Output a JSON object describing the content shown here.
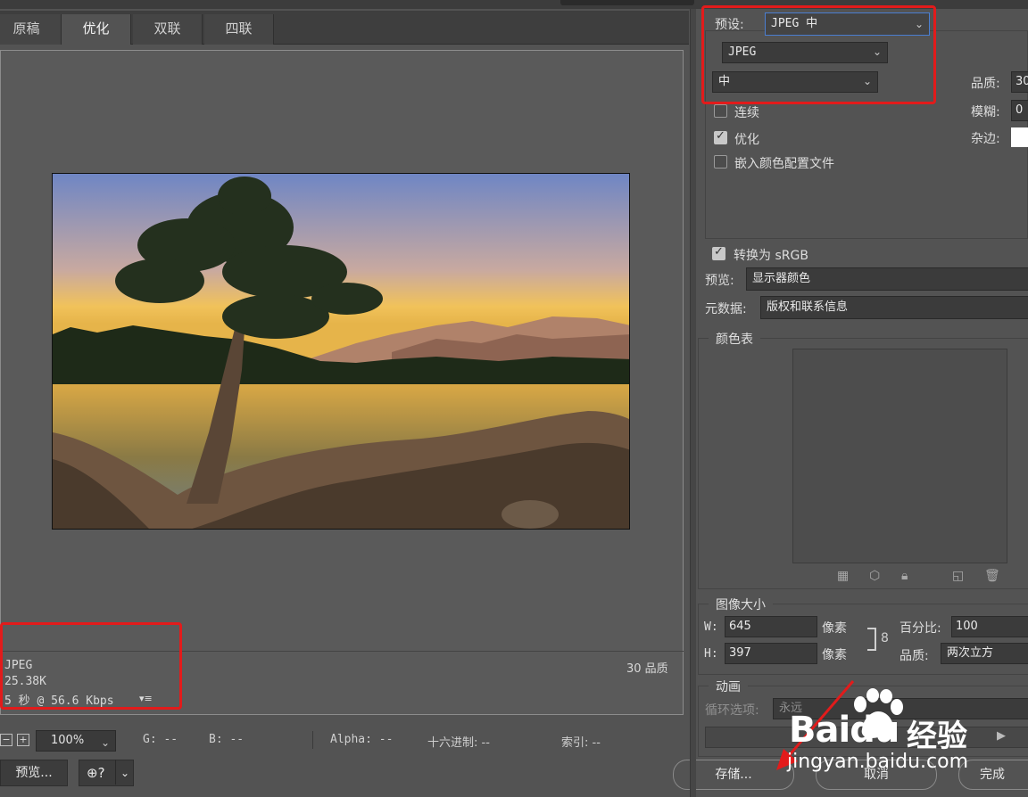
{
  "tabs": [
    {
      "label": "原稿",
      "active": false
    },
    {
      "label": "优化",
      "active": true
    },
    {
      "label": "双联",
      "active": false
    },
    {
      "label": "四联",
      "active": false
    }
  ],
  "image_info": {
    "format": "JPEG",
    "size": "25.38K",
    "time": "5 秒 @ 56.6 Kbps",
    "quality": "30 品质"
  },
  "statusbar": {
    "zoom": "100%",
    "g": "G: --",
    "b": "B: --",
    "alpha": "Alpha: --",
    "hex": "十六进制: --",
    "index": "索引: --"
  },
  "buttons": {
    "preview": "预览...",
    "save": "存储...",
    "cancel": "取消",
    "done": "完成"
  },
  "settings": {
    "preset_label": "预设:",
    "preset_value": "JPEG 中",
    "format_value": "JPEG",
    "quality_level": "中",
    "quality_label": "品质:",
    "quality_value": "30",
    "blur_label": "模糊:",
    "blur_value": "0",
    "matte_label": "杂边:",
    "progressive_label": "连续",
    "progressive_checked": false,
    "optimized_label": "优化",
    "optimized_checked": true,
    "embed_profile_label": "嵌入颜色配置文件",
    "embed_profile_checked": false,
    "convert_srgb_label": "转换为 sRGB",
    "convert_srgb_checked": true,
    "preview_label": "预览:",
    "preview_value": "显示器颜色",
    "metadata_label": "元数据:",
    "metadata_value": "版权和联系信息"
  },
  "color_table": {
    "title": "颜色表"
  },
  "image_size": {
    "title": "图像大小",
    "w_label": "W:",
    "w_value": "645",
    "h_label": "H:",
    "h_value": "397",
    "unit": "像素",
    "percent_label": "百分比:",
    "percent_value": "100",
    "quality_label": "品质:",
    "quality_value": "两次立方"
  },
  "animation": {
    "title": "动画",
    "loop_label": "循环选项:",
    "loop_value": "永远"
  },
  "watermark": {
    "brand": "Baidu",
    "brand_cn": "经验",
    "url": "jingyan.baidu.com"
  },
  "colors": {
    "annotation_red": "#e21b1b",
    "panel_bg": "#535353",
    "field_bg": "#3b3b3b"
  }
}
